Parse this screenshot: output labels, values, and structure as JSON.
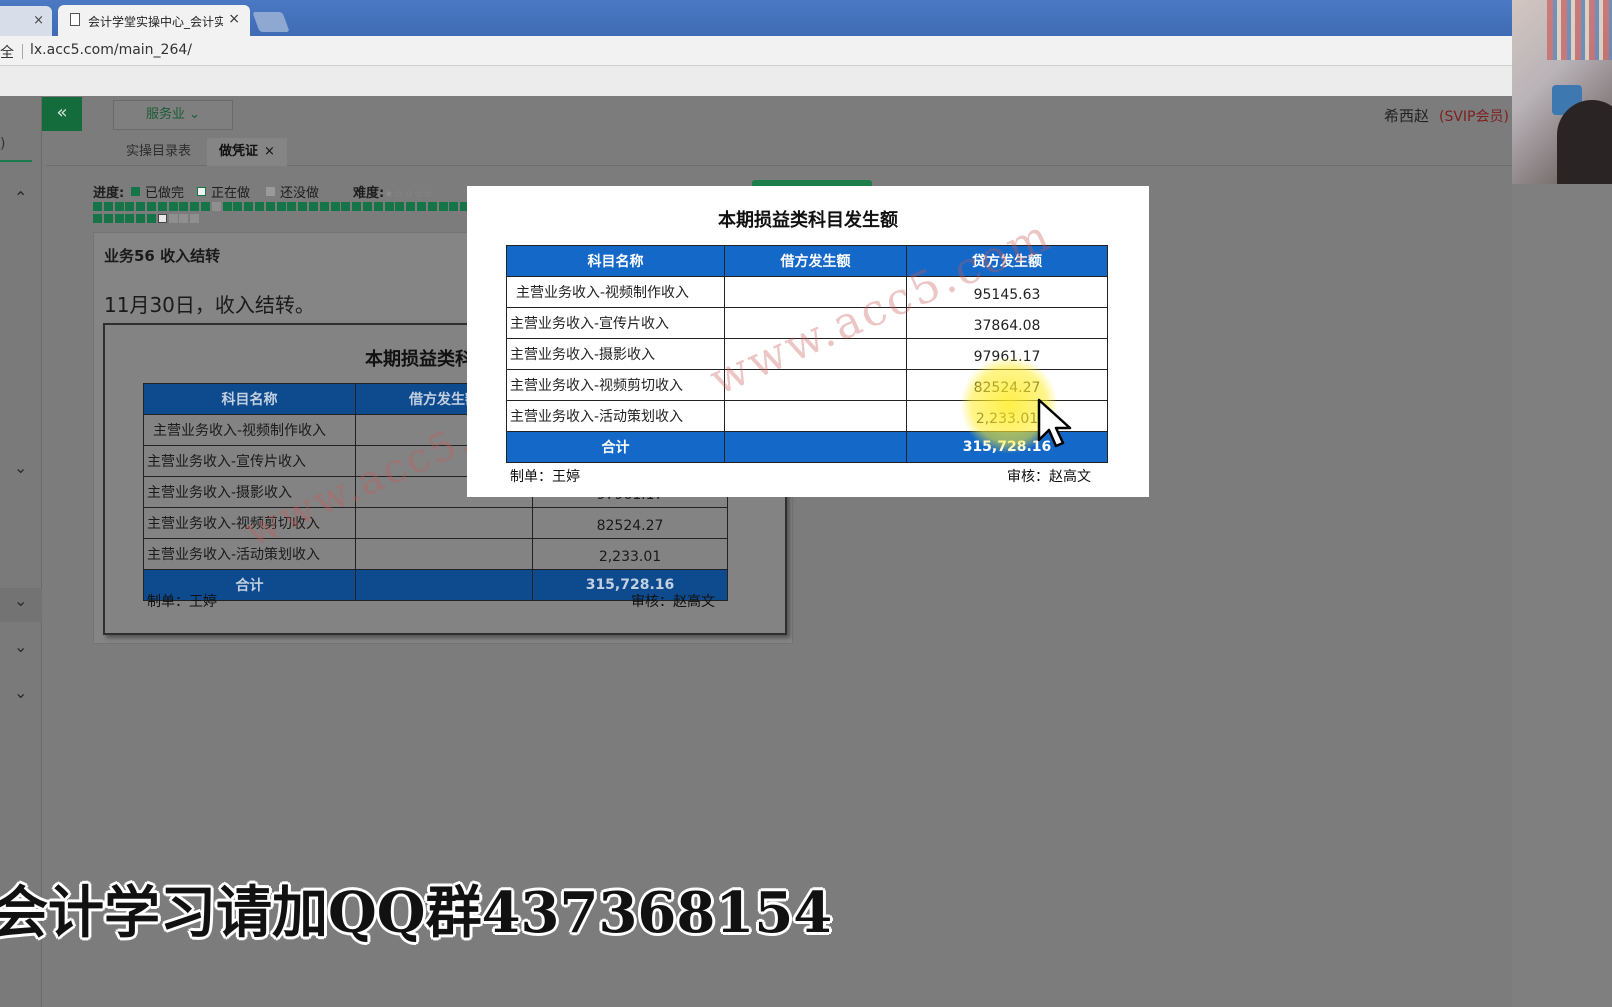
{
  "browser": {
    "tab_active_title": "会计学堂实操中心_会计实",
    "tab_close": "×",
    "url_prefix": "全",
    "url": "lx.acc5.com/main_264/"
  },
  "header": {
    "collapse_label": "«",
    "industry_label": "服务业 ⌄",
    "user_name": "希西赵",
    "user_level": "(SVIP会员)"
  },
  "sidebar": {
    "paren": ")",
    "chevrons": [
      "⌃",
      "⌄",
      "⌄",
      "⌄",
      "⌄"
    ]
  },
  "page_tabs": [
    {
      "label": "实操目录表"
    },
    {
      "label": "做凭证",
      "close": "×"
    }
  ],
  "progress": {
    "label": "进度:",
    "legend_done": "已做完",
    "legend_doing": "正在做",
    "legend_todo": "还没做",
    "difficulty_label": "难度:",
    "difficulty_stars": "★☆☆☆☆",
    "colors": {
      "done": "#157448",
      "doing": "#ffffff",
      "todo": "#8f8f8f"
    }
  },
  "business": {
    "title": "业务56 收入结转",
    "date_text": "11月30日，收入结转。"
  },
  "report": {
    "title": "本期损益类科目发生额",
    "headers": [
      "科目名称",
      "借方发生额",
      "贷方发生额"
    ],
    "rows": [
      {
        "name": "主营业务收入-视频制作收入",
        "debit": "",
        "credit": "95145.63"
      },
      {
        "name": "主营业务收入-宣传片收入",
        "debit": "",
        "credit": "37864.08"
      },
      {
        "name": "主营业务收入-摄影收入",
        "debit": "",
        "credit": "97961.17"
      },
      {
        "name": "主营业务收入-视频剪切收入",
        "debit": "",
        "credit": "82524.27"
      },
      {
        "name": "主营业务收入-活动策划收入",
        "debit": "",
        "credit": "2,233.01"
      }
    ],
    "total_label": "合计",
    "total_debit": "",
    "total_credit": "315,728.16",
    "maker": "制单：王婷",
    "reviewer": "审核：赵高文",
    "watermark": "www.acc5.com",
    "header_color": "#1469c8"
  },
  "overlay": {
    "subtitle": "会计学习请加QQ群437368154"
  }
}
